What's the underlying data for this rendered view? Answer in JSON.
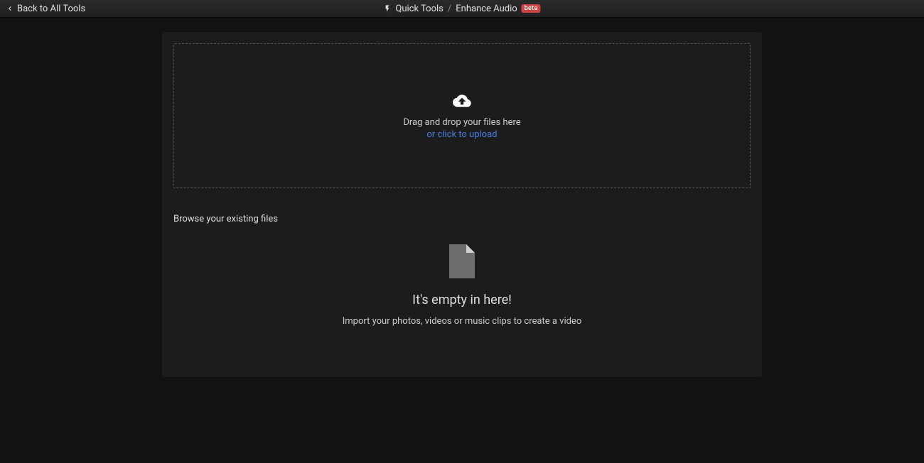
{
  "topbar": {
    "back_label": "Back to All Tools",
    "breadcrumb": {
      "root": "Quick Tools",
      "current": "Enhance Audio",
      "badge": "beta"
    }
  },
  "dropzone": {
    "primary": "Drag and drop your files here",
    "secondary": "or click to upload"
  },
  "browse": {
    "heading": "Browse your existing files",
    "empty_title": "It's empty in here!",
    "empty_subtitle": "Import your photos, videos or music clips to create a video"
  }
}
